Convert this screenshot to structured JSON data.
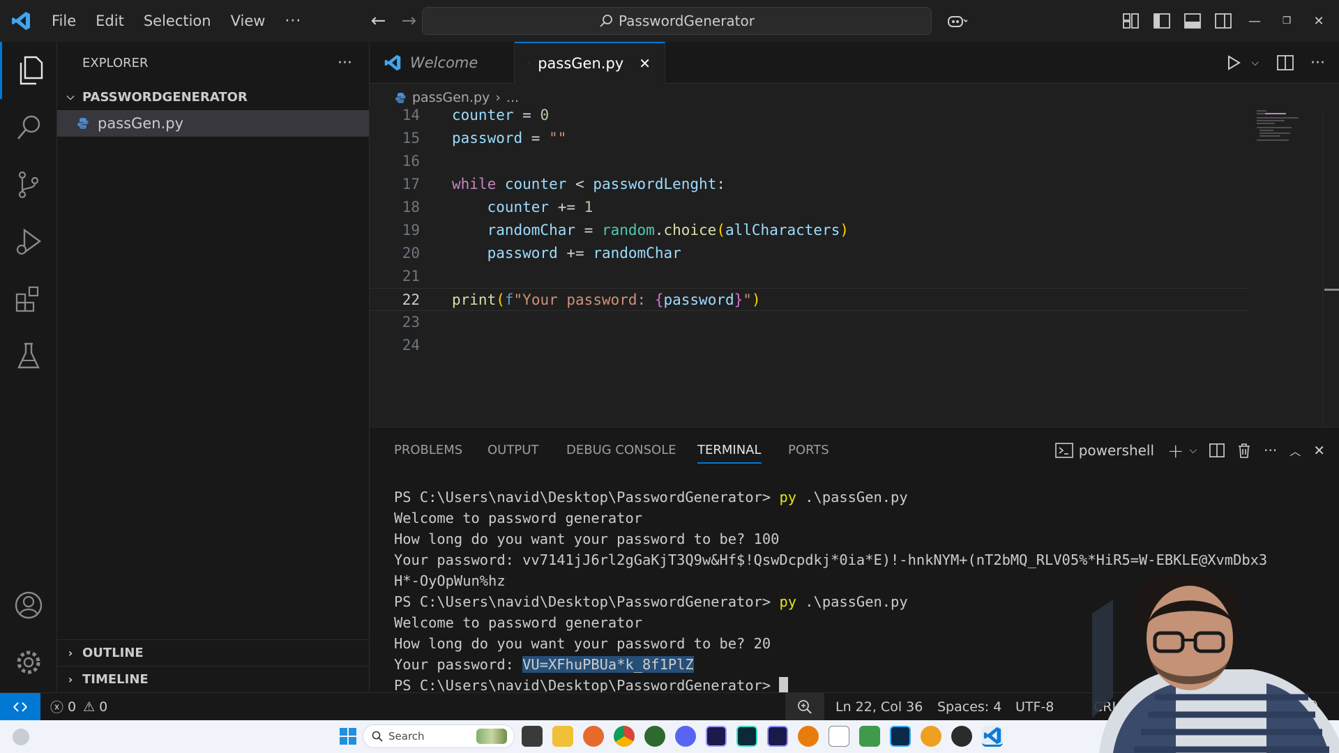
{
  "titlebar": {
    "menus": [
      "File",
      "Edit",
      "Selection",
      "View"
    ],
    "more": "···",
    "search_text": "PasswordGenerator"
  },
  "sidebar": {
    "title": "EXPLORER",
    "more": "···",
    "folder": "PASSWORDGENERATOR",
    "file": "passGen.py",
    "outline": "OUTLINE",
    "timeline": "TIMELINE"
  },
  "tabs": {
    "welcome": "Welcome",
    "active": "passGen.py"
  },
  "breadcrumb": {
    "file": "passGen.py",
    "sep": "›",
    "rest": "..."
  },
  "code": {
    "line_numbers": [
      "14",
      "15",
      "16",
      "17",
      "18",
      "19",
      "20",
      "21",
      "22",
      "23",
      "24"
    ],
    "current_line": "22",
    "l14_var": "counter",
    "l14_op": " = ",
    "l14_num": "0",
    "l15_var": "password",
    "l15_op": " = ",
    "l15_str": "\"\"",
    "l17_kw": "while",
    "l17_a": "counter",
    "l17_op": " < ",
    "l17_b": "passwordLenght",
    "l17_colon": ":",
    "l18_var": "counter",
    "l18_op": " += ",
    "l18_num": "1",
    "l19_var": "randomChar",
    "l19_op": " = ",
    "l19_mod": "random",
    "l19_dot": ".",
    "l19_fn": "choice",
    "l19_p1": "(",
    "l19_arg": "allCharacters",
    "l19_p2": ")",
    "l20_var": "password",
    "l20_op": " += ",
    "l20_b": "randomChar",
    "l22_fn": "print",
    "l22_p1": "(",
    "l22_f": "f",
    "l22_str": "\"Your password: ",
    "l22_b1": "{",
    "l22_var": "password",
    "l22_b2": "}",
    "l22_str2": "\"",
    "l22_p2": ")"
  },
  "panel": {
    "tabs": [
      "PROBLEMS",
      "OUTPUT",
      "DEBUG CONSOLE",
      "TERMINAL",
      "PORTS"
    ],
    "active_tab": "TERMINAL",
    "shell": "powershell"
  },
  "terminal": {
    "prompt1": "PS C:\\Users\\navid\\Desktop\\PasswordGenerator> ",
    "cmd1": "py",
    "arg1": " .\\passGen.py",
    "out1": "Welcome to password generator",
    "out2": "How long do you want your password to be? 100",
    "out3": "Your password: vv7141jJ6rl2gGaKjT3Q9w&Hf$!QswDcpdkj*0ia*E)!-hnkNYM+(nT2bMQ_RLV05%*HiR5=W-EBKLE@XvmDbx3",
    "out4": "H*-OyOpWun%hz",
    "prompt2": "PS C:\\Users\\navid\\Desktop\\PasswordGenerator> ",
    "cmd2": "py",
    "arg2": " .\\passGen.py",
    "out5": "Welcome to password generator",
    "out6": "How long do you want your password to be? 20",
    "out7_label": "Your password: ",
    "out7_value": "VU=XFhuPBUa*k_8f1PlZ",
    "prompt3": "PS C:\\Users\\navid\\Desktop\\PasswordGenerator> "
  },
  "statusbar": {
    "errors": "0",
    "warnings": "0",
    "position": "Ln 22, Col 36",
    "spaces": "Spaces: 4",
    "encoding": "UTF-8",
    "eol": "CRLF"
  },
  "taskbar": {
    "search": "Search",
    "apps": [
      "file-explorer",
      "firefox",
      "chrome",
      "xbox",
      "discord",
      "premiere",
      "audition",
      "media-encoder",
      "blender",
      "calendar",
      "keepass",
      "photoshop",
      "app",
      "obs",
      "vscode"
    ]
  },
  "colors": {
    "accent": "#0078d4",
    "editor_bg": "#1f1f1f",
    "sidebar_bg": "#181818",
    "taskbar_bg": "#f0f3f9"
  }
}
